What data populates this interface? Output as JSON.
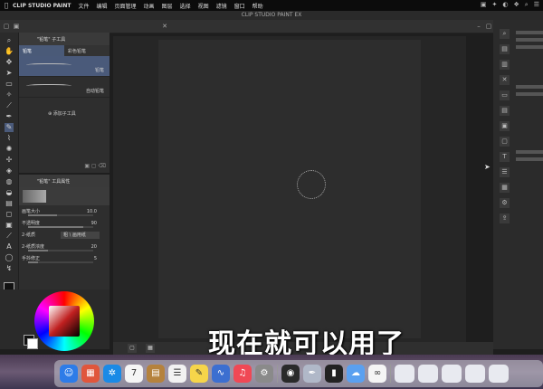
{
  "menubar": {
    "apple": "",
    "app_name": "CLIP STUDIO PAINT",
    "items": [
      "文件",
      "编辑",
      "页面管理",
      "动画",
      "图层",
      "选择",
      "视图",
      "滤镜",
      "窗口",
      "帮助"
    ],
    "status_icons": [
      "▣",
      "✦",
      "◐",
      "❖",
      "⌕",
      "☰"
    ]
  },
  "window": {
    "title": "CLIP STUDIO PAINT EX"
  },
  "sub_tool_panel": {
    "tab_label": "\"铅笔\" 子工具",
    "tabs": [
      "铅笔",
      "彩色铅笔"
    ],
    "brushes": [
      "铅笔",
      "自动铅笔"
    ],
    "add_label": "添加子工具"
  },
  "tool_property": {
    "tab_label": "\"铅笔\" 工具属性",
    "rows": [
      {
        "label": "画笔大小",
        "value": "10.0",
        "fill": 0.45
      },
      {
        "label": "不透明度",
        "value": "90",
        "fill": 0.85
      },
      {
        "label": "2-纸质",
        "value": "",
        "dropdown": "粗 \\ 画用纸"
      },
      {
        "label": "2-纸质浓度",
        "value": "20",
        "fill": 0.3
      },
      {
        "label": "手抖修正",
        "value": "5",
        "fill": 0.15
      }
    ]
  },
  "subtitle": "现在就可以用了",
  "dock": {
    "icons": [
      {
        "name": "finder",
        "glyph": "☺",
        "color": "#2d7ce8"
      },
      {
        "name": "launchpad",
        "glyph": "▦",
        "color": "#e0563c"
      },
      {
        "name": "safari",
        "glyph": "✲",
        "color": "#1a8ae6"
      },
      {
        "name": "calendar",
        "glyph": "7",
        "color": "#f5f5f5"
      },
      {
        "name": "contacts",
        "glyph": "▤",
        "color": "#b5823d"
      },
      {
        "name": "reminders",
        "glyph": "☰",
        "color": "#f2f2f2"
      },
      {
        "name": "notes",
        "glyph": "✎",
        "color": "#f6d54a"
      },
      {
        "name": "stocks",
        "glyph": "∿",
        "color": "#3c6fd0"
      },
      {
        "name": "music",
        "glyph": "♫",
        "color": "#f04855"
      },
      {
        "name": "system-settings",
        "glyph": "⚙",
        "color": "#8a8a8a"
      },
      {
        "name": "qq",
        "glyph": "◉",
        "color": "#2a2a2a"
      },
      {
        "name": "clip-studio",
        "glyph": "✒",
        "color": "#b0b8c8"
      },
      {
        "name": "terminal",
        "glyph": "▮",
        "color": "#222"
      },
      {
        "name": "baidu-disk",
        "glyph": "☁",
        "color": "#5aa0f0"
      },
      {
        "name": "link-app",
        "glyph": "∞",
        "color": "#f5f5f5"
      }
    ],
    "thumbnails": 5
  }
}
